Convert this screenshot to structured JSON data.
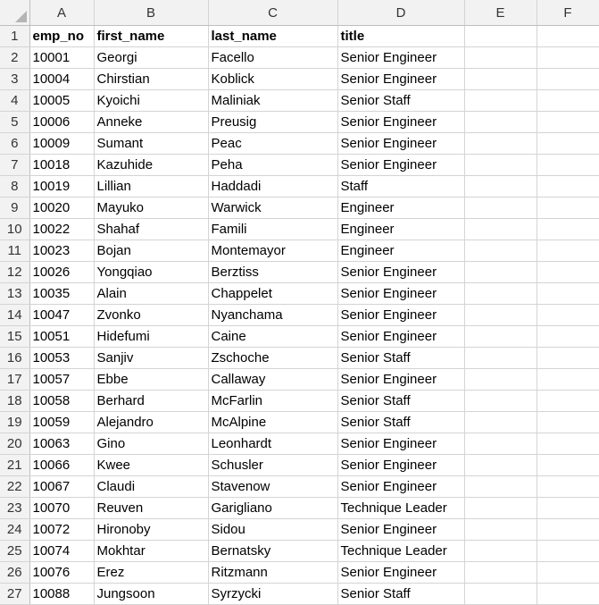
{
  "columns": [
    "A",
    "B",
    "C",
    "D",
    "E",
    "F"
  ],
  "header": [
    "emp_no",
    "first_name",
    "last_name",
    "title"
  ],
  "rows": [
    [
      "10001",
      "Georgi",
      "Facello",
      "Senior Engineer"
    ],
    [
      "10004",
      "Chirstian",
      "Koblick",
      "Senior Engineer"
    ],
    [
      "10005",
      "Kyoichi",
      "Maliniak",
      "Senior Staff"
    ],
    [
      "10006",
      "Anneke",
      "Preusig",
      "Senior Engineer"
    ],
    [
      "10009",
      "Sumant",
      "Peac",
      "Senior Engineer"
    ],
    [
      "10018",
      "Kazuhide",
      "Peha",
      "Senior Engineer"
    ],
    [
      "10019",
      "Lillian",
      "Haddadi",
      "Staff"
    ],
    [
      "10020",
      "Mayuko",
      "Warwick",
      "Engineer"
    ],
    [
      "10022",
      "Shahaf",
      "Famili",
      "Engineer"
    ],
    [
      "10023",
      "Bojan",
      "Montemayor",
      "Engineer"
    ],
    [
      "10026",
      "Yongqiao",
      "Berztiss",
      "Senior Engineer"
    ],
    [
      "10035",
      "Alain",
      "Chappelet",
      "Senior Engineer"
    ],
    [
      "10047",
      "Zvonko",
      "Nyanchama",
      "Senior Engineer"
    ],
    [
      "10051",
      "Hidefumi",
      "Caine",
      "Senior Engineer"
    ],
    [
      "10053",
      "Sanjiv",
      "Zschoche",
      "Senior Staff"
    ],
    [
      "10057",
      "Ebbe",
      "Callaway",
      "Senior Engineer"
    ],
    [
      "10058",
      "Berhard",
      "McFarlin",
      "Senior Staff"
    ],
    [
      "10059",
      "Alejandro",
      "McAlpine",
      "Senior Staff"
    ],
    [
      "10063",
      "Gino",
      "Leonhardt",
      "Senior Engineer"
    ],
    [
      "10066",
      "Kwee",
      "Schusler",
      "Senior Engineer"
    ],
    [
      "10067",
      "Claudi",
      "Stavenow",
      "Senior Engineer"
    ],
    [
      "10070",
      "Reuven",
      "Garigliano",
      "Technique Leader"
    ],
    [
      "10072",
      "Hironoby",
      "Sidou",
      "Senior Engineer"
    ],
    [
      "10074",
      "Mokhtar",
      "Bernatsky",
      "Technique Leader"
    ],
    [
      "10076",
      "Erez",
      "Ritzmann",
      "Senior Engineer"
    ],
    [
      "10088",
      "Jungsoon",
      "Syrzycki",
      "Senior Staff"
    ]
  ]
}
